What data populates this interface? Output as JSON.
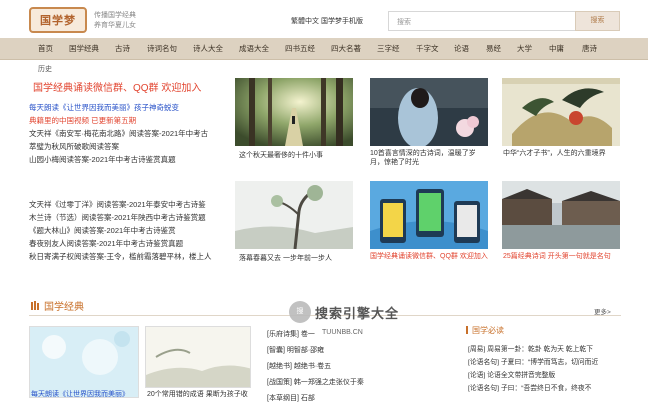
{
  "header": {
    "logo_text": "国学梦",
    "slogan_line1": "传播国学经典",
    "slogan_line2": "养育华夏儿女",
    "lang_link": "繁體中文 国学梦手机版",
    "search_placeholder": "搜索",
    "search_button": "搜索"
  },
  "nav": {
    "items": [
      "首页",
      "国学经典",
      "古诗",
      "诗词名句",
      "诗人大全",
      "成语大全",
      "四书五经",
      "四大名著",
      "三字经",
      "千字文",
      "论语",
      "易经",
      "大学",
      "中庸",
      "唐诗"
    ]
  },
  "breadcrumb": "历史",
  "left": {
    "headline": "国学经典诵读微信群、QQ群 欢迎加入",
    "list1": [
      {
        "text": "每天朗读《让世界因我而美丽》孩子神奇蜕变",
        "color": "#2b54c9"
      },
      {
        "text": "典籍里的中国视频 已更新第五期",
        "color": "#e2442f"
      },
      {
        "text": "文天祥《南安军·梅花南北路》阅读答案-2021年中考古",
        "color": "#333"
      },
      {
        "text": "萃璧为秋风所破歌阅读答案",
        "color": "#333"
      },
      {
        "text": "山园小梅阅读答案-2021年中考古诗鉴赏真题",
        "color": "#333"
      }
    ],
    "list2": [
      "文天祥《过零丁洋》阅读答案-2021年泰安中考古诗鉴",
      "木兰诗（节选）阅读答案-2021年陕西中考古诗鉴赏题",
      "《题大林山》阅读答案-2021年中考古诗鉴赏",
      "春夜别友人阅读答案-2021年中考古诗鉴赏真题",
      "秋日寄满子权阅读答案-王令，槛前霜落碧平林，楼上人"
    ]
  },
  "grid": {
    "captions": [
      "这个秋天最奢侈的十件小事",
      "10首喜言情深的古诗词，温暖了岁月，惊艳了时光",
      "中华“六才子书”，人生的六重境界",
      "落幕春暮又去 一步年前一步人",
      "国学经典诵读微信群、QQ群 欢迎加入",
      "25篇经典诗词 开头第一句就是名句"
    ]
  },
  "section": {
    "title": "国学经典",
    "more": "更多>",
    "thumb_caption1": "每天朗读《让世界因我而美丽》",
    "thumb_caption2": "20个常用错的成语 果断为孩子收",
    "list": [
      "[乐府诗集] 卷一",
      "[智囊] 明智部·邵雍",
      "[越绝书] 越绝书·卷五",
      "[战国策] 韩一郑强之走张仪于秦",
      "[本草纲目] 石部"
    ],
    "side_title": "国学必读",
    "side_list": [
      "[周易] 周易第一卦：乾卦 乾为天 乾上乾下",
      "[论语名句] 子夏曰：“博学而笃志，切问而近",
      "[论语] 论语全文带拼音完整版",
      "[论语名句] 子曰：“吾尝终日不食，终夜不"
    ]
  },
  "watermark": {
    "circle_text": "搜",
    "text": "搜索引擎大全",
    "sub": "TUUNBB.CN"
  }
}
